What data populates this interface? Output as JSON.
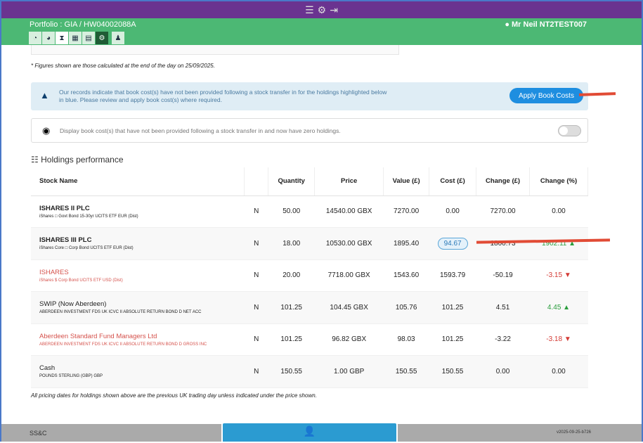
{
  "header": {
    "portfolio": "Portfolio : GIA / HW04002088A",
    "user": "Mr Neil NT2TEST007",
    "top_icons": [
      "menu-icon",
      "gear-icon",
      "logout-icon"
    ],
    "nav_icons": [
      "dashboard-icon",
      "pie-icon",
      "transfer-icon",
      "table-icon",
      "statement-icon",
      "settings-icon",
      "person-icon"
    ]
  },
  "note": "* Figures shown are those calculated at the end of the day on 25/09/2025.",
  "alert": {
    "text": "Our records indicate that book cost(s) have not been provided following a stock transfer in for the holdings highlighted below in blue. Please review and apply book cost(s) where required.",
    "button": "Apply Book Costs"
  },
  "toggle": {
    "text": "Display book cost(s) that have not been provided following a stock transfer in and now have zero holdings.",
    "on": false
  },
  "holdings_title": "Holdings performance",
  "columns": [
    "Stock Name",
    "",
    "Quantity",
    "Price",
    "Value (£)",
    "Cost (£)",
    "Change (£)",
    "Change (%)"
  ],
  "rows": [
    {
      "name": "ISHARES II PLC",
      "sub": "iShares □ Govt Bond 15-30yr UCITS ETF EUR (Dist)",
      "flag": "N",
      "qty": "50.00",
      "price": "14540.00 GBX",
      "value": "7270.00",
      "cost": "0.00",
      "change": "7270.00",
      "pct": "0.00",
      "style": "",
      "dir": ""
    },
    {
      "name": "ISHARES III PLC",
      "sub": "iShares Core □ Corp Bond UCITS ETF EUR (Dist)",
      "flag": "N",
      "qty": "18.00",
      "price": "10530.00 GBX",
      "value": "1895.40",
      "cost": "94.67",
      "change": "1800.73",
      "pct": "1902.11",
      "style": "",
      "dir": "up",
      "highlight": true
    },
    {
      "name": "ISHARES",
      "sub": "iShares $ Corp Bond UCITS ETF USD (Dist)",
      "flag": "N",
      "qty": "20.00",
      "price": "7718.00 GBX",
      "value": "1543.60",
      "cost": "1593.79",
      "change": "-50.19",
      "pct": "-3.15",
      "style": "red",
      "dir": "down"
    },
    {
      "name": "SWIP (Now Aberdeen)",
      "sub": "ABERDEEN INVESTMENT FDS UK ICVC II ABSOLUTE RETURN BOND D NET ACC",
      "flag": "N",
      "qty": "101.25",
      "price": "104.45 GBX",
      "value": "105.76",
      "cost": "101.25",
      "change": "4.51",
      "pct": "4.45",
      "style": "",
      "dir": "up"
    },
    {
      "name": "Aberdeen Standard Fund Managers Ltd",
      "sub": "ABERDEEN INVESTMENT FDS UK ICVC II ABSOLUTE RETURN BOND D GROSS INC",
      "flag": "N",
      "qty": "101.25",
      "price": "96.82 GBX",
      "value": "98.03",
      "cost": "101.25",
      "change": "-3.22",
      "pct": "-3.18",
      "style": "red",
      "dir": "down"
    },
    {
      "name": "Cash",
      "sub": "POUNDS STERLING (GBP) GBP",
      "flag": "N",
      "qty": "150.55",
      "price": "1.00 GBP",
      "value": "150.55",
      "cost": "150.55",
      "change": "0.00",
      "pct": "0.00",
      "style": "",
      "dir": ""
    }
  ],
  "footnote": "All pricing dates for holdings shown above are the previous UK trading day unless indicated under the price shown.",
  "footer": {
    "brand": "SS&C",
    "version": "v2025-09-25-b726"
  },
  "colors": {
    "purple": "#6a3390",
    "green": "#4cb874",
    "accent": "#1e8ee0",
    "annotation": "#e14b35"
  }
}
